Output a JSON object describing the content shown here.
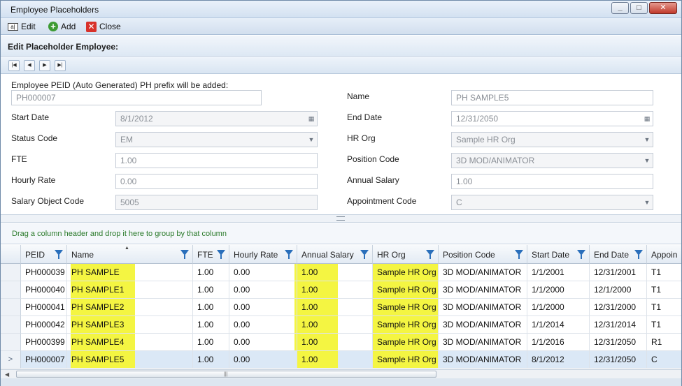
{
  "window": {
    "title": "Employee Placeholders"
  },
  "toolbar": {
    "edit_label": "Edit",
    "add_label": "Add",
    "close_label": "Close"
  },
  "section": {
    "title": "Edit Placeholder Employee:"
  },
  "form": {
    "peid_label": "Employee PEID  (Auto Generated) PH prefix will be added:",
    "peid_value": "PH000007",
    "name_label": "Name",
    "name_value": "PH SAMPLE5",
    "start_date_label": "Start Date",
    "start_date_value": "8/1/2012",
    "end_date_label": "End Date",
    "end_date_value": "12/31/2050",
    "status_code_label": "Status Code",
    "status_code_value": "EM",
    "hr_org_label": "HR Org",
    "hr_org_value": "Sample HR Org",
    "fte_label": "FTE",
    "fte_value": "1.00",
    "position_code_label": "Position Code",
    "position_code_value": "3D MOD/ANIMATOR",
    "hourly_rate_label": "Hourly Rate",
    "hourly_rate_value": "0.00",
    "annual_salary_label": "Annual Salary",
    "annual_salary_value": "1.00",
    "salary_object_code_label": "Salary Object Code",
    "salary_object_code_value": "5005",
    "appointment_code_label": "Appointment Code",
    "appointment_code_value": "C"
  },
  "grid": {
    "group_hint": "Drag a column header and drop it here to group by that column",
    "columns": [
      "PEID",
      "Name",
      "FTE",
      "Hourly Rate",
      "Annual Salary",
      "HR Org",
      "Position Code",
      "Start Date",
      "End Date",
      "Appoin"
    ],
    "rows": [
      [
        "PH000039",
        "PH SAMPLE",
        "1.00",
        "0.00",
        "1.00",
        "Sample HR Org",
        "3D MOD/ANIMATOR",
        "1/1/2001",
        "12/31/2001",
        "T1"
      ],
      [
        "PH000040",
        "PH SAMPLE1",
        "1.00",
        "0.00",
        "1.00",
        "Sample HR Org",
        "3D MOD/ANIMATOR",
        "1/1/2000",
        "12/1/2000",
        "T1"
      ],
      [
        "PH000041",
        "PH SAMPLE2",
        "1.00",
        "0.00",
        "1.00",
        "Sample HR Org",
        "3D MOD/ANIMATOR",
        "1/1/2000",
        "12/31/2000",
        "T1"
      ],
      [
        "PH000042",
        "PH SAMPLE3",
        "1.00",
        "0.00",
        "1.00",
        "Sample HR Org",
        "3D MOD/ANIMATOR",
        "1/1/2014",
        "12/31/2014",
        "T1"
      ],
      [
        "PH000399",
        "PH SAMPLE4",
        "1.00",
        "0.00",
        "1.00",
        "Sample HR Org",
        "3D MOD/ANIMATOR",
        "1/1/2016",
        "12/31/2050",
        "R1"
      ],
      [
        "PH000007",
        "PH SAMPLE5",
        "1.00",
        "0.00",
        "1.00",
        "Sample HR Org",
        "3D MOD/ANIMATOR",
        "8/1/2012",
        "12/31/2050",
        "C"
      ]
    ],
    "selected_row_marker": ">"
  },
  "colors": {
    "highlight": "#f4f542",
    "filter_icon": "#2a6fbb",
    "selected_row": "#dbe8f6"
  }
}
